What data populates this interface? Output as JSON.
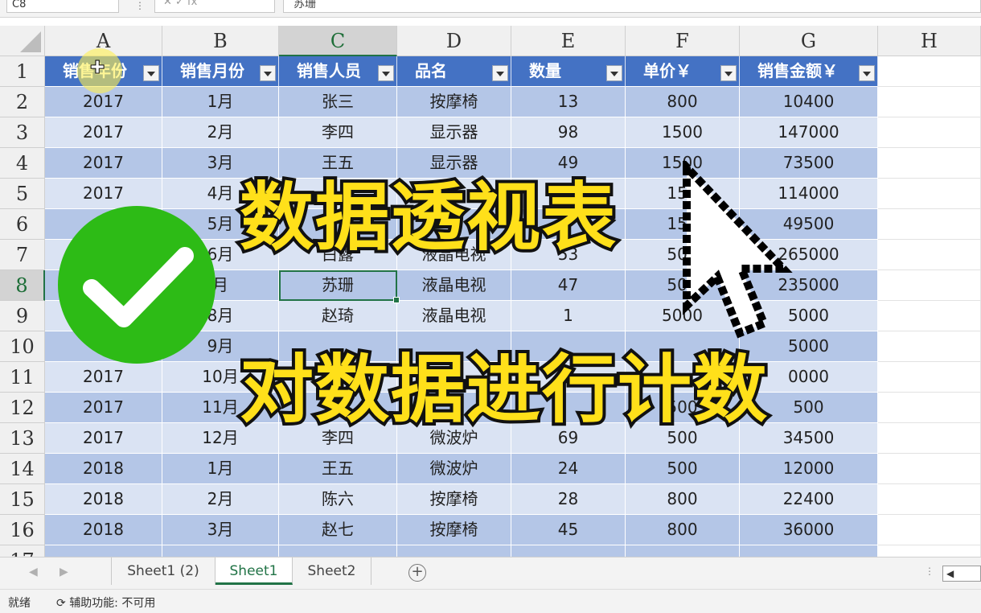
{
  "formula_bar": {
    "name_box": "C8",
    "fx_dots": "⋮",
    "fx_buttons": "✕   ✓   fx",
    "content": "苏珊"
  },
  "columns": [
    "A",
    "B",
    "C",
    "D",
    "E",
    "F",
    "G",
    "H"
  ],
  "rows": [
    "1",
    "2",
    "3",
    "4",
    "5",
    "6",
    "7",
    "8",
    "9",
    "10",
    "11",
    "12",
    "13",
    "14",
    "15",
    "16",
    "17"
  ],
  "table": {
    "headers": [
      "销售年份",
      "销售月份",
      "销售人员",
      "品名",
      "数量",
      "单价￥",
      "销售金额￥"
    ],
    "data": [
      [
        "2017",
        "1月",
        "张三",
        "按摩椅",
        "13",
        "800",
        "10400"
      ],
      [
        "2017",
        "2月",
        "李四",
        "显示器",
        "98",
        "1500",
        "147000"
      ],
      [
        "2017",
        "3月",
        "王五",
        "显示器",
        "49",
        "1500",
        "73500"
      ],
      [
        "2017",
        "4月",
        "",
        "",
        "",
        "150",
        "114000"
      ],
      [
        "",
        "5月",
        "",
        "",
        "",
        "150",
        "49500"
      ],
      [
        "",
        "6月",
        "白露",
        "液晶电视",
        "53",
        "500",
        "265000"
      ],
      [
        "",
        "月",
        "苏珊",
        "液晶电视",
        "47",
        "500",
        "235000"
      ],
      [
        "",
        "8月",
        "赵琦",
        "液晶电视",
        "1",
        "5000",
        "5000"
      ],
      [
        "",
        "9月",
        "",
        "",
        "",
        "",
        "5000"
      ],
      [
        "2017",
        "10月",
        "",
        "",
        "",
        "",
        "0000"
      ],
      [
        "2017",
        "11月",
        "",
        "",
        "",
        "500",
        "500"
      ],
      [
        "2017",
        "12月",
        "李四",
        "微波炉",
        "69",
        "500",
        "34500"
      ],
      [
        "2018",
        "1月",
        "王五",
        "微波炉",
        "24",
        "500",
        "12000"
      ],
      [
        "2018",
        "2月",
        "陈六",
        "按摩椅",
        "28",
        "800",
        "22400"
      ],
      [
        "2018",
        "3月",
        "赵七",
        "按摩椅",
        "45",
        "800",
        "36000"
      ]
    ]
  },
  "sheet_tabs": [
    "Sheet1 (2)",
    "Sheet1",
    "Sheet2"
  ],
  "active_tab": "Sheet1",
  "tab_nav": {
    "prev": "◀",
    "next": "▶"
  },
  "add_sheet": "+",
  "status": {
    "ready": "就绪",
    "accessibility": "辅助功能: 不可用"
  },
  "overlay": {
    "title1": "数据透视表",
    "title2": "对数据进行计数"
  },
  "colors": {
    "header_blue": "#4472c4",
    "band_dark": "#b4c6e7",
    "band_light": "#dae3f3",
    "excel_green": "#217346",
    "overlay_yellow": "#ffe01a",
    "check_green": "#2dbb16"
  }
}
